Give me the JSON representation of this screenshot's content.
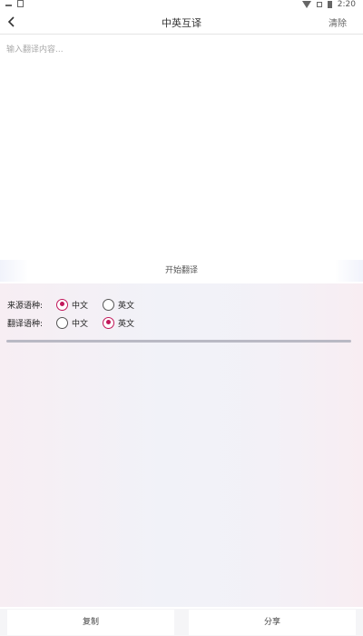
{
  "status_bar": {
    "time": "2:20"
  },
  "header": {
    "back_icon": "chevron-left-icon",
    "title": "中英互译",
    "clear_label": "清除"
  },
  "input": {
    "placeholder": "输入翻译内容...",
    "value": ""
  },
  "translate_button": {
    "label": "开始翻译"
  },
  "source_language": {
    "label": "来源语种:",
    "options": [
      "中文",
      "英文"
    ],
    "selected": "中文"
  },
  "target_language": {
    "label": "翻译语种:",
    "options": [
      "中文",
      "英文"
    ],
    "selected": "英文"
  },
  "result": {
    "text": ""
  },
  "footer": {
    "copy_label": "复制",
    "share_label": "分享"
  },
  "colors": {
    "accent": "#c2185b",
    "panel_background": "#f3f1f7"
  }
}
